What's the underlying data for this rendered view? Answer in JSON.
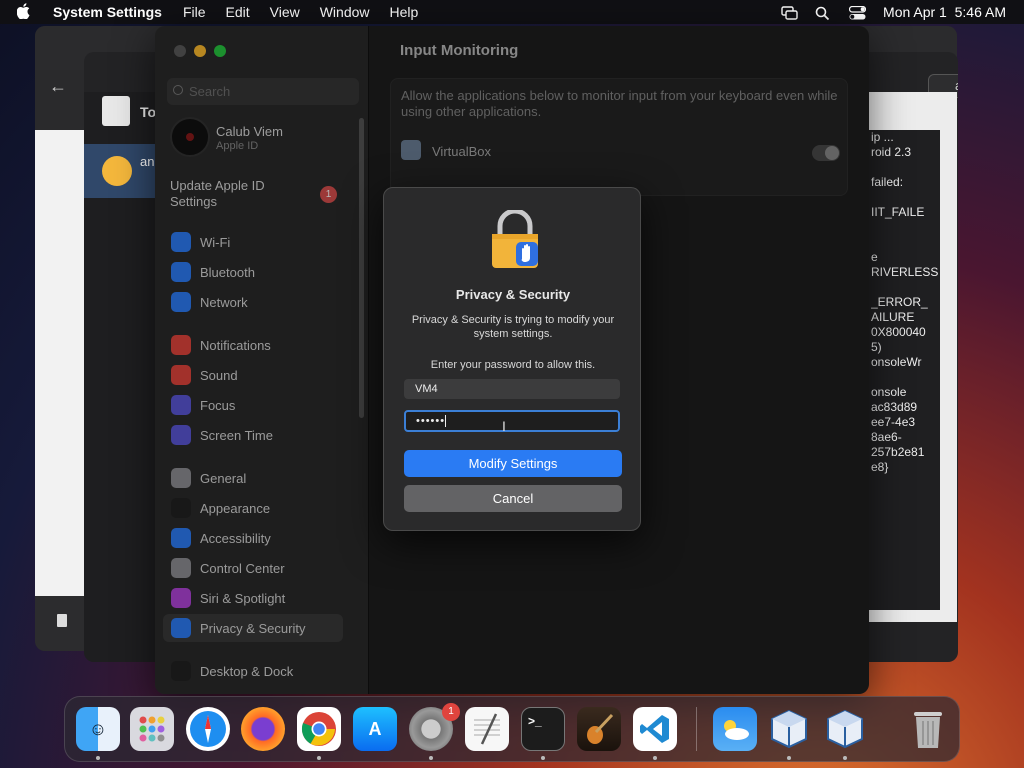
{
  "menubar": {
    "app": "System Settings",
    "menus": [
      "File",
      "Edit",
      "View",
      "Window",
      "Help"
    ],
    "clock": "Mon Apr 1  5:46 AM"
  },
  "vm_window": {
    "sidebar_label": "To",
    "vm_label": "an",
    "update_label": "ate",
    "log_lines": [
      "ip ...",
      "roid 2.3",
      "",
      "failed:",
      "",
      "IIT_FAILE",
      "",
      "",
      "e",
      "RIVERLESS",
      "",
      "_ERROR_",
      "AILURE",
      "0X800040",
      "5)",
      "onsoleWr",
      "",
      "onsole",
      "ac83d89",
      "ee7-4e3",
      "8ae6-",
      "257b2e81",
      "e8}"
    ]
  },
  "settings": {
    "search_placeholder": "Search",
    "account_name": "Calub Viem",
    "account_sub": "Apple ID",
    "update_notice": "Update Apple ID\nSettings",
    "update_badge": "1",
    "sidebar": [
      {
        "label": "Wi-Fi",
        "icon": "wifi-icon",
        "color": "#2d7cf6"
      },
      {
        "label": "Bluetooth",
        "icon": "bluetooth-icon",
        "color": "#2d7cf6"
      },
      {
        "label": "Network",
        "icon": "network-icon",
        "color": "#2d7cf6"
      },
      {
        "label": "Notifications",
        "icon": "bell-icon",
        "color": "#e1453c"
      },
      {
        "label": "Sound",
        "icon": "speaker-icon",
        "color": "#e1453c"
      },
      {
        "label": "Focus",
        "icon": "moon-icon",
        "color": "#5b57d6"
      },
      {
        "label": "Screen Time",
        "icon": "hourglass-icon",
        "color": "#5b57d6"
      },
      {
        "label": "General",
        "icon": "gear-icon",
        "color": "#8e8e93"
      },
      {
        "label": "Appearance",
        "icon": "appearance-icon",
        "color": "#222222"
      },
      {
        "label": "Accessibility",
        "icon": "accessibility-icon",
        "color": "#2d7cf6"
      },
      {
        "label": "Control Center",
        "icon": "control-center-icon",
        "color": "#8e8e93"
      },
      {
        "label": "Siri & Spotlight",
        "icon": "siri-icon",
        "color": "#b044d8"
      },
      {
        "label": "Privacy & Security",
        "icon": "hand-icon",
        "color": "#2d7cf6"
      },
      {
        "label": "Desktop & Dock",
        "icon": "dock-icon",
        "color": "#222222"
      }
    ],
    "main_title": "Input Monitoring",
    "panel_desc": "Allow the applications below to monitor input from your keyboard even while using other applications.",
    "panel_app": "VirtualBox"
  },
  "dialog": {
    "title": "Privacy & Security",
    "message": "Privacy & Security is trying to modify your system settings.",
    "ask": "Enter your password to allow this.",
    "username": "VM4",
    "password": "••••••",
    "modify_label": "Modify Settings",
    "cancel_label": "Cancel"
  },
  "dock": {
    "items": [
      "Finder",
      "Launchpad",
      "Safari",
      "Firefox",
      "Chrome",
      "App Store",
      "System Settings",
      "TextEdit",
      "Terminal",
      "GarageBand",
      "VS Code",
      "Weather",
      "VirtualBox",
      "VirtualBox VM",
      "Trash"
    ],
    "settings_badge": "1"
  },
  "colors": {
    "accent": "#2a7bf3",
    "menubar": "#101014"
  }
}
